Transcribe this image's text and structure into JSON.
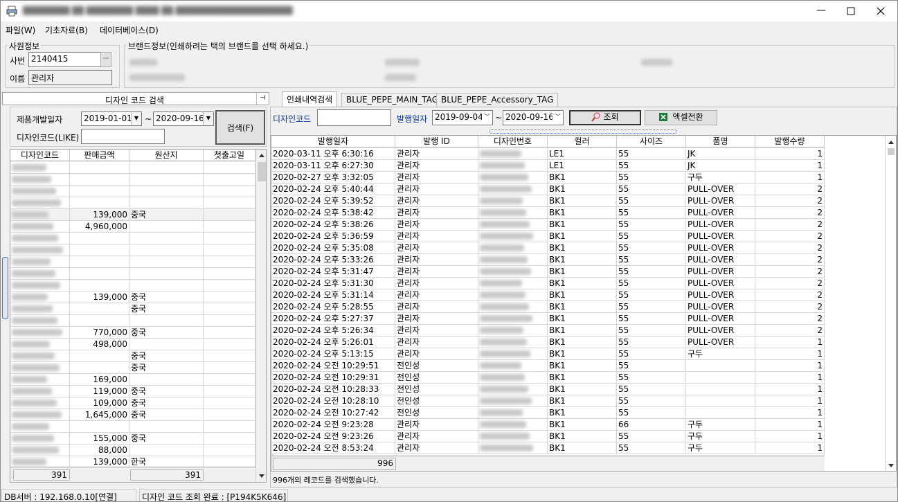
{
  "window": {
    "title_blurred": "████████ ██ ████████ ████ ██ ████████████████████"
  },
  "menu": [
    {
      "label": "파일(W)"
    },
    {
      "label": "기초자료(B)"
    },
    {
      "label": "데이터베이스(D)"
    }
  ],
  "employee": {
    "group_title": "사원정보",
    "id_label": "사번",
    "id_value": "2140415",
    "name_label": "이름",
    "name_value": "관리자",
    "lookup_glyph": "···"
  },
  "brand": {
    "group_title": "브랜드정보(인쇄하려는 택의 브랜드를 선택 하세요.)"
  },
  "left_panel": {
    "title": "디자인 코드 검색",
    "pin_glyph": "⊣",
    "date_label": "제품개발일자",
    "date_from": "2019-01-01",
    "date_to": "2020-09-16",
    "tilde": "~",
    "code_label": "디자인코드(LIKE)",
    "code_value": "",
    "search_button": "검색(F)",
    "columns": [
      "디자인코드",
      "판매금액",
      "원산지",
      "첫출고일"
    ],
    "rows": [
      {
        "price": "",
        "origin": ""
      },
      {
        "price": "",
        "origin": ""
      },
      {
        "price": "",
        "origin": ""
      },
      {
        "price": "",
        "origin": ""
      },
      {
        "price": "139,000",
        "origin": "중국"
      },
      {
        "price": "4,960,000",
        "origin": ""
      },
      {
        "price": "",
        "origin": ""
      },
      {
        "price": "",
        "origin": ""
      },
      {
        "price": "",
        "origin": ""
      },
      {
        "price": "",
        "origin": ""
      },
      {
        "price": "",
        "origin": ""
      },
      {
        "price": "139,000",
        "origin": "중국"
      },
      {
        "price": "",
        "origin": "중국"
      },
      {
        "price": "",
        "origin": ""
      },
      {
        "price": "770,000",
        "origin": "중국"
      },
      {
        "price": "498,000",
        "origin": ""
      },
      {
        "price": "",
        "origin": "중국"
      },
      {
        "price": "",
        "origin": "중국"
      },
      {
        "price": "169,000",
        "origin": ""
      },
      {
        "price": "119,000",
        "origin": "중국"
      },
      {
        "price": "109,000",
        "origin": "중국"
      },
      {
        "price": "1,645,000",
        "origin": "중국"
      },
      {
        "price": "",
        "origin": ""
      },
      {
        "price": "155,000",
        "origin": "중국"
      },
      {
        "price": "88,000",
        "origin": ""
      },
      {
        "price": "139,000",
        "origin": "한국"
      }
    ],
    "footer_left": "391",
    "footer_right": "391"
  },
  "tabs": [
    {
      "label": "인쇄내역검색",
      "active": true
    },
    {
      "label": "BLUE_PEPE_MAIN_TAG",
      "active": false
    },
    {
      "label": "BLUE_PEPE_Accessory_TAG",
      "active": false
    }
  ],
  "right_panel": {
    "code_label": "디자인코드",
    "code_value": "",
    "issue_label": "발행일자",
    "date_from": "2019-09-04",
    "date_to": "2020-09-16",
    "tilde": "~",
    "search_button": "조회",
    "excel_button": "엑셀전환",
    "columns": [
      "발행일자",
      "발행 ID",
      "디자인번호",
      "컬러",
      "사이즈",
      "품명",
      "발행수량"
    ],
    "rows": [
      {
        "date": "2020-03-11 오후 6:30:16",
        "issuer": "관리자",
        "color": "LE1",
        "size": "55",
        "item": "JK",
        "qty": "1"
      },
      {
        "date": "2020-03-11 오후 6:27:30",
        "issuer": "관리자",
        "color": "LE1",
        "size": "55",
        "item": "JK",
        "qty": "1"
      },
      {
        "date": "2020-02-27 오후 3:32:05",
        "issuer": "관리자",
        "color": "BK1",
        "size": "55",
        "item": "구두",
        "qty": "1"
      },
      {
        "date": "2020-02-24 오후 5:40:44",
        "issuer": "관리자",
        "color": "BK1",
        "size": "55",
        "item": "PULL-OVER",
        "qty": "2"
      },
      {
        "date": "2020-02-24 오후 5:39:52",
        "issuer": "관리자",
        "color": "BK1",
        "size": "55",
        "item": "PULL-OVER",
        "qty": "2"
      },
      {
        "date": "2020-02-24 오후 5:38:42",
        "issuer": "관리자",
        "color": "BK1",
        "size": "55",
        "item": "PULL-OVER",
        "qty": "2"
      },
      {
        "date": "2020-02-24 오후 5:38:26",
        "issuer": "관리자",
        "color": "BK1",
        "size": "55",
        "item": "PULL-OVER",
        "qty": "2"
      },
      {
        "date": "2020-02-24 오후 5:36:59",
        "issuer": "관리자",
        "color": "BK1",
        "size": "55",
        "item": "PULL-OVER",
        "qty": "2"
      },
      {
        "date": "2020-02-24 오후 5:35:08",
        "issuer": "관리자",
        "color": "BK1",
        "size": "55",
        "item": "PULL-OVER",
        "qty": "2"
      },
      {
        "date": "2020-02-24 오후 5:33:26",
        "issuer": "관리자",
        "color": "BK1",
        "size": "55",
        "item": "PULL-OVER",
        "qty": "2"
      },
      {
        "date": "2020-02-24 오후 5:31:47",
        "issuer": "관리자",
        "color": "BK1",
        "size": "55",
        "item": "PULL-OVER",
        "qty": "2"
      },
      {
        "date": "2020-02-24 오후 5:31:30",
        "issuer": "관리자",
        "color": "BK1",
        "size": "55",
        "item": "PULL-OVER",
        "qty": "2"
      },
      {
        "date": "2020-02-24 오후 5:31:14",
        "issuer": "관리자",
        "color": "BK1",
        "size": "55",
        "item": "PULL-OVER",
        "qty": "2"
      },
      {
        "date": "2020-02-24 오후 5:28:55",
        "issuer": "관리자",
        "color": "BK1",
        "size": "55",
        "item": "PULL-OVER",
        "qty": "2"
      },
      {
        "date": "2020-02-24 오후 5:27:37",
        "issuer": "관리자",
        "color": "BK1",
        "size": "55",
        "item": "PULL-OVER",
        "qty": "2"
      },
      {
        "date": "2020-02-24 오후 5:26:34",
        "issuer": "관리자",
        "color": "BK1",
        "size": "55",
        "item": "PULL-OVER",
        "qty": "2"
      },
      {
        "date": "2020-02-24 오후 5:26:01",
        "issuer": "관리자",
        "color": "BK1",
        "size": "55",
        "item": "PULL-OVER",
        "qty": "1"
      },
      {
        "date": "2020-02-24 오후 5:13:15",
        "issuer": "관리자",
        "color": "BK1",
        "size": "55",
        "item": "구두",
        "qty": "1"
      },
      {
        "date": "2020-02-24 오전 10:29:51",
        "issuer": "전인성",
        "color": "BK1",
        "size": "55",
        "item": "",
        "qty": "1"
      },
      {
        "date": "2020-02-24 오전 10:29:31",
        "issuer": "전인성",
        "color": "BK1",
        "size": "55",
        "item": "",
        "qty": "1"
      },
      {
        "date": "2020-02-24 오전 10:28:33",
        "issuer": "전인성",
        "color": "BK1",
        "size": "55",
        "item": "",
        "qty": "1"
      },
      {
        "date": "2020-02-24 오전 10:28:10",
        "issuer": "전인성",
        "color": "BK1",
        "size": "55",
        "item": "",
        "qty": "1"
      },
      {
        "date": "2020-02-24 오전 10:27:42",
        "issuer": "전인성",
        "color": "BK1",
        "size": "55",
        "item": "",
        "qty": "1"
      },
      {
        "date": "2020-02-24 오전 9:23:28",
        "issuer": "관리자",
        "color": "BK1",
        "size": "66",
        "item": "구두",
        "qty": "1"
      },
      {
        "date": "2020-02-24 오전 9:23:26",
        "issuer": "관리자",
        "color": "BK1",
        "size": "55",
        "item": "구두",
        "qty": "1"
      },
      {
        "date": "2020-02-24 오전 8:53:24",
        "issuer": "관리자",
        "color": "BK1",
        "size": "55",
        "item": "구두",
        "qty": "1"
      }
    ],
    "footer_count": "996",
    "result_text": "996개의 레코드를 검색했습니다."
  },
  "statusbar": {
    "db_server": "DB서버 : 192.168.0.10[연결]",
    "message": "디자인 코드 조회 완료 : [P194K5K646]"
  },
  "colors": {
    "accent_blue": "#0033a0",
    "excel_green": "#1d7b3a"
  }
}
